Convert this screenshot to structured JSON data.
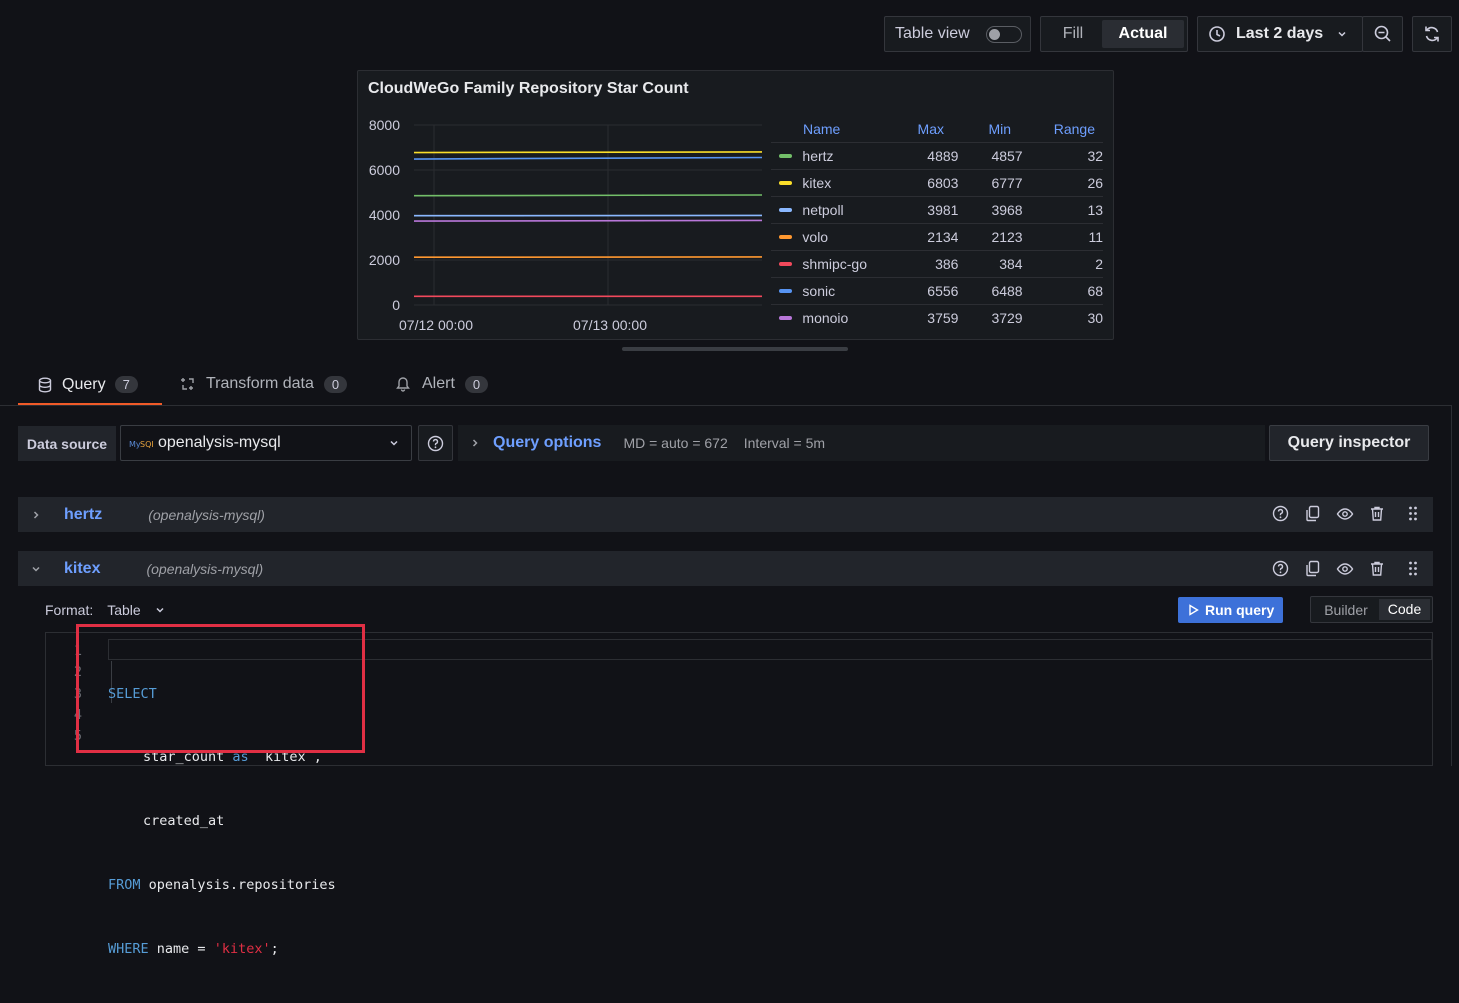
{
  "toolbar": {
    "table_view_label": "Table view",
    "fill_label": "Fill",
    "actual_label": "Actual",
    "time_range": "Last 2 days"
  },
  "panel": {
    "title": "CloudWeGo Family Repository Star Count",
    "legend_headers": {
      "name": "Name",
      "max": "Max",
      "min": "Min",
      "range": "Range"
    },
    "legend": [
      {
        "name": "hertz",
        "max": "4889",
        "min": "4857",
        "range": "32",
        "color": "#73bf69"
      },
      {
        "name": "kitex",
        "max": "6803",
        "min": "6777",
        "range": "26",
        "color": "#fade2a"
      },
      {
        "name": "netpoll",
        "max": "3981",
        "min": "3968",
        "range": "13",
        "color": "#8ab8ff"
      },
      {
        "name": "volo",
        "max": "2134",
        "min": "2123",
        "range": "11",
        "color": "#ff9830"
      },
      {
        "name": "shmipc-go",
        "max": "386",
        "min": "384",
        "range": "2",
        "color": "#f2495c"
      },
      {
        "name": "sonic",
        "max": "6556",
        "min": "6488",
        "range": "68",
        "color": "#5794f2"
      },
      {
        "name": "monoio",
        "max": "3759",
        "min": "3729",
        "range": "30",
        "color": "#b877d9"
      }
    ]
  },
  "chart_data": {
    "type": "line",
    "title": "CloudWeGo Family Repository Star Count",
    "x_ticks": [
      "07/12 00:00",
      "07/13 00:00"
    ],
    "y_ticks": [
      "0",
      "2000",
      "4000",
      "6000",
      "8000"
    ],
    "ylim": [
      0,
      8000
    ],
    "grid": true,
    "legend_placement": "right",
    "series": [
      {
        "name": "hertz",
        "values": [
          4857,
          4889
        ],
        "color": "#73bf69"
      },
      {
        "name": "kitex",
        "values": [
          6777,
          6803
        ],
        "color": "#fade2a"
      },
      {
        "name": "netpoll",
        "values": [
          3968,
          3981
        ],
        "color": "#8ab8ff"
      },
      {
        "name": "volo",
        "values": [
          2123,
          2134
        ],
        "color": "#ff9830"
      },
      {
        "name": "shmipc-go",
        "values": [
          384,
          386
        ],
        "color": "#f2495c"
      },
      {
        "name": "sonic",
        "values": [
          6488,
          6556
        ],
        "color": "#5794f2"
      },
      {
        "name": "monoio",
        "values": [
          3729,
          3759
        ],
        "color": "#b877d9"
      }
    ]
  },
  "tabs": [
    {
      "label": "Query",
      "count": "7"
    },
    {
      "label": "Transform data",
      "count": "0"
    },
    {
      "label": "Alert",
      "count": "0"
    }
  ],
  "datasource": {
    "label": "Data source",
    "value": "openalysis-mysql",
    "query_options_label": "Query options",
    "md_info": "MD = auto = 672",
    "interval_info": "Interval = 5m",
    "inspector_label": "Query inspector"
  },
  "queries": [
    {
      "name": "hertz",
      "source": "(openalysis-mysql)"
    },
    {
      "name": "kitex",
      "source": "(openalysis-mysql)"
    }
  ],
  "editor": {
    "format_label": "Format:",
    "format_value": "Table",
    "run_label": "Run query",
    "builder_label": "Builder",
    "code_label": "Code",
    "line_numbers": [
      "1",
      "2",
      "3",
      "4",
      "5"
    ],
    "l1_kw": "SELECT",
    "l2_a": "star_count",
    "l2_kw": "as",
    "l2_b": "`kitex`,",
    "l3": "created_at",
    "l4_kw": "FROM",
    "l4_b": "openalysis.repositories",
    "l5_kw": "WHERE",
    "l5_b": "name =",
    "l5_str": "'kitex'",
    "l5_end": ";"
  },
  "colors": {
    "accent": "#3d71d9",
    "tab_active": "#f05a28",
    "highlight_box": "#e02f44"
  }
}
